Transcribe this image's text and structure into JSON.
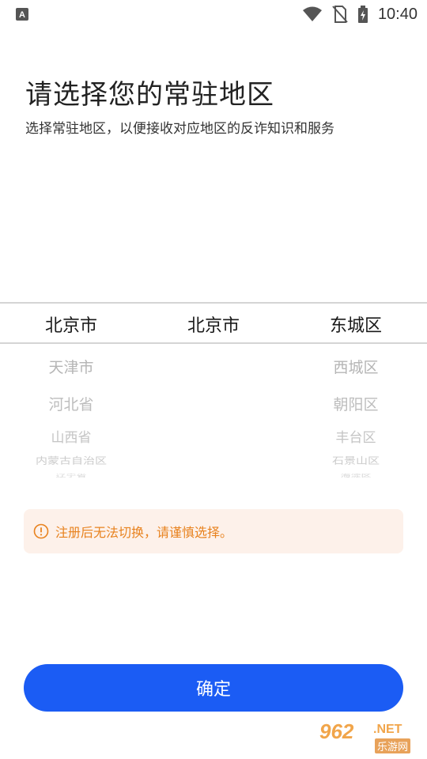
{
  "status_bar": {
    "time": "10:40",
    "icons": [
      "notification-a-icon",
      "wifi-icon",
      "no-sim-icon",
      "battery-charging-icon"
    ]
  },
  "header": {
    "title": "请选择您的常驻地区",
    "subtitle": "选择常驻地区，以便接收对应地区的反诈知识和服务"
  },
  "picker": {
    "province": {
      "selected": "北京市",
      "below": [
        "天津市",
        "河北省",
        "山西省",
        "内蒙古自治区",
        "辽宁省"
      ]
    },
    "city": {
      "selected": "北京市",
      "below": []
    },
    "district": {
      "selected": "东城区",
      "below": [
        "西城区",
        "朝阳区",
        "丰台区",
        "石景山区",
        "海淀区"
      ]
    }
  },
  "notice": {
    "text": "注册后无法切换，请谨慎选择。",
    "color": "#e8821e"
  },
  "confirm": {
    "label": "确定",
    "color": "#1b5cf4"
  },
  "watermark": {
    "brand": "962",
    "suffix": ".NET",
    "sub": "乐游网"
  }
}
